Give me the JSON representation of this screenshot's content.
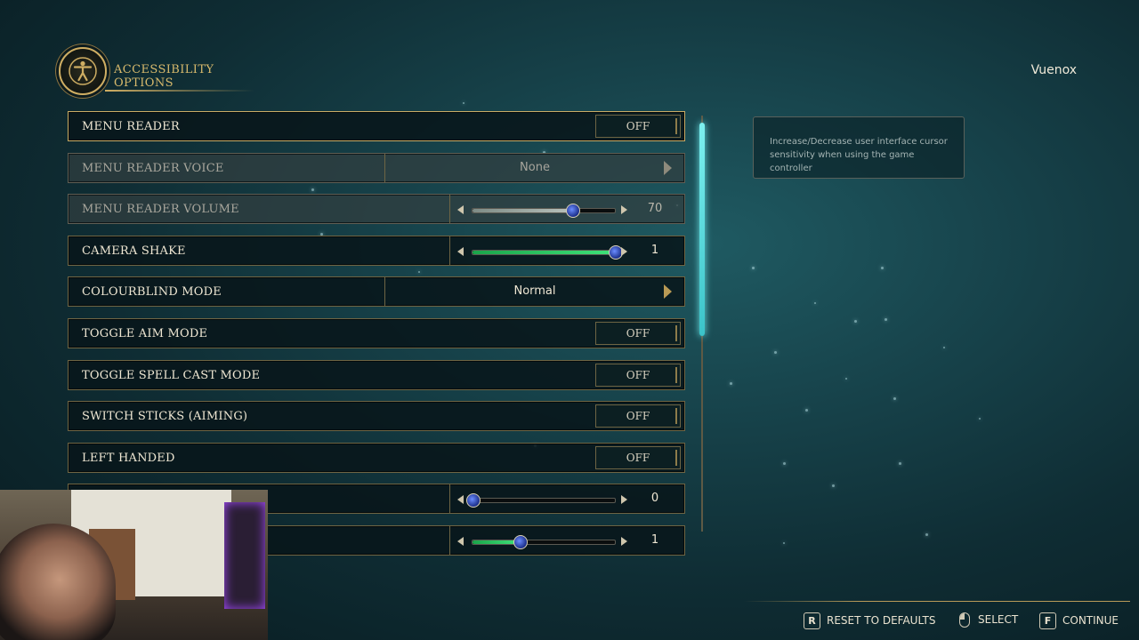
{
  "header": {
    "title": "ACCESSIBILITY OPTIONS",
    "icon": "accessibility-icon"
  },
  "user": {
    "name": "Vuenox"
  },
  "rows": [
    {
      "label": "MENU READER",
      "type": "toggle",
      "value": "OFF",
      "state": "selected"
    },
    {
      "label": "MENU READER VOICE",
      "type": "selector",
      "value": "None",
      "state": "disabled"
    },
    {
      "label": "MENU READER VOLUME",
      "type": "slider",
      "value": "70",
      "fraction": 0.7,
      "state": "disabled"
    },
    {
      "label": "CAMERA SHAKE",
      "type": "slider",
      "value": "1",
      "fraction": 1.0,
      "state": "normal"
    },
    {
      "label": "COLOURBLIND MODE",
      "type": "selector",
      "value": "Normal",
      "state": "normal"
    },
    {
      "label": "TOGGLE AIM MODE",
      "type": "toggle",
      "value": "OFF",
      "state": "normal"
    },
    {
      "label": "TOGGLE SPELL CAST MODE",
      "type": "toggle",
      "value": "OFF",
      "state": "normal"
    },
    {
      "label": "SWITCH STICKS (AIMING)",
      "type": "toggle",
      "value": "OFF",
      "state": "normal"
    },
    {
      "label": "LEFT HANDED",
      "type": "toggle",
      "value": "OFF",
      "state": "normal"
    },
    {
      "label": "",
      "type": "slider",
      "value": "0",
      "fraction": 0.0,
      "state": "normal"
    },
    {
      "label": "",
      "type": "slider",
      "value": "1",
      "fraction": 0.33,
      "state": "normal"
    }
  ],
  "tooltip": {
    "text": "Increase/Decrease user interface cursor sensitivity when using the game controller"
  },
  "footer": {
    "reset": {
      "key": "R",
      "label": "RESET TO DEFAULTS"
    },
    "select": {
      "icon": "mouse-icon",
      "label": "SELECT"
    },
    "continue": {
      "key": "F",
      "label": "CONTINUE"
    }
  },
  "colors": {
    "accent_gold": "#cfae63",
    "slider_green": "#3fe37a",
    "scroll_cyan": "#7df0f0"
  }
}
